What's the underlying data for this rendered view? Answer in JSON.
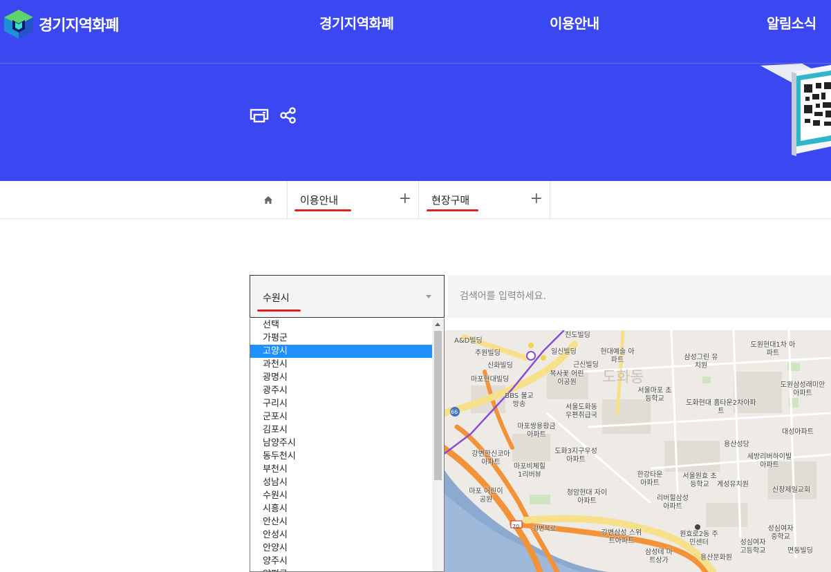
{
  "header": {
    "logo_text": "경기지역화폐",
    "nav": [
      "경기지역화폐",
      "이용안내",
      "알림소식"
    ],
    "icons": [
      "print-icon",
      "share-icon"
    ]
  },
  "breadcrumb": {
    "home_icon": "home-icon",
    "items": [
      {
        "label": "이용안내",
        "toggle": "+"
      },
      {
        "label": "현장구매",
        "toggle": "+"
      }
    ]
  },
  "search": {
    "region_selected": "수원시",
    "placeholder": "검색어를 입력하세요."
  },
  "region_options": [
    "선택",
    "가평군",
    "고양시",
    "과천시",
    "광명시",
    "광주시",
    "구리시",
    "군포시",
    "김포시",
    "남양주시",
    "동두천시",
    "부천시",
    "성남시",
    "수원시",
    "시흥시",
    "안산시",
    "안성시",
    "안양시",
    "양주시",
    "양평군"
  ],
  "highlighted_option": "고양시",
  "map": {
    "labels": [
      "A&D빌딩",
      "주원빌딩",
      "신화빌딩",
      "마포현대빌딩",
      "진도빌딩",
      "일신빌딩",
      "근신빌딩",
      "복사꽃 어린이공원",
      "BBS 불교방송",
      "현대예술 아파트",
      "도화동",
      "서울마포 초등학교",
      "삼성그린 유치원",
      "도원현대1차 아파트",
      "도원삼성래미안 아파트",
      "서울도화동 우편취급국",
      "도화현대 홈타운2차아파트",
      "마포쌍용황금 아파트",
      "대성아파트",
      "용산성당",
      "강변한신코아 아파트",
      "도화3지구우성 아파트",
      "세방리버하이빌 아파트",
      "마포비체힐 1리버뷰",
      "한강타운 아파트",
      "서울원효 초등학교",
      "계성유치원",
      "신창제일교회",
      "마포 어린이공원",
      "청암현대 자이아파트",
      "리버힐삼성 아파트",
      "강변북로",
      "강변삼성 스위트아파트",
      "원효로2동 주민센터",
      "성심여자 고등학교",
      "성심여자 중학교",
      "삼성테 마트상가",
      "용산문화원",
      "면동빌딩",
      "70",
      "66"
    ]
  },
  "colors": {
    "brand_blue": "#3b47f0",
    "accent_red": "#e0201f",
    "select_highlight": "#1e90ff"
  }
}
